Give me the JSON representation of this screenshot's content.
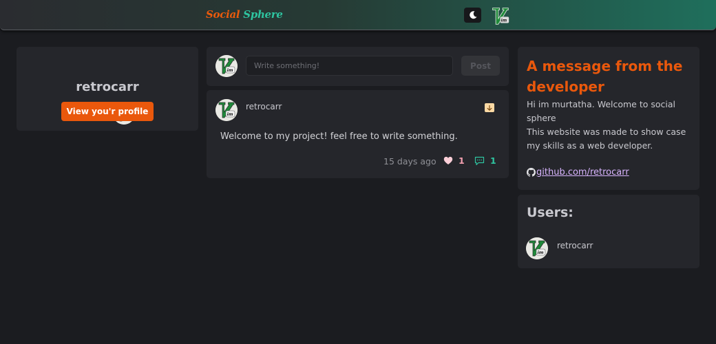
{
  "header": {
    "brand_part1": "Social",
    "brand_part2": "Sphere",
    "theme_toggle_icon": "moon-icon",
    "user_avatar_icon": "vim-logo-avatar"
  },
  "profile": {
    "username": "retrocarr",
    "view_profile_label": "View you'r profile"
  },
  "composer": {
    "placeholder": "Write something!",
    "post_label": "Post"
  },
  "posts": [
    {
      "username": "retrocarr",
      "text": "Welcome to my project! feel free to write something.",
      "time": "15 days ago",
      "likes": "1",
      "comments": "1"
    }
  ],
  "developer": {
    "title": "A message from the developer",
    "line1": "Hi im murtatha. Welcome to social sphere",
    "line2": "This website was made to show case my skills as a web developer.",
    "link_text": " github.com/retrocarr"
  },
  "users": {
    "title": "Users:",
    "list": [
      {
        "name": "retrocarr"
      }
    ]
  },
  "colors": {
    "accent_orange": "#ea580c",
    "accent_teal": "#2ec4a0",
    "link_purple": "#d8b4fe",
    "like_pink": "#f4a0b0"
  }
}
